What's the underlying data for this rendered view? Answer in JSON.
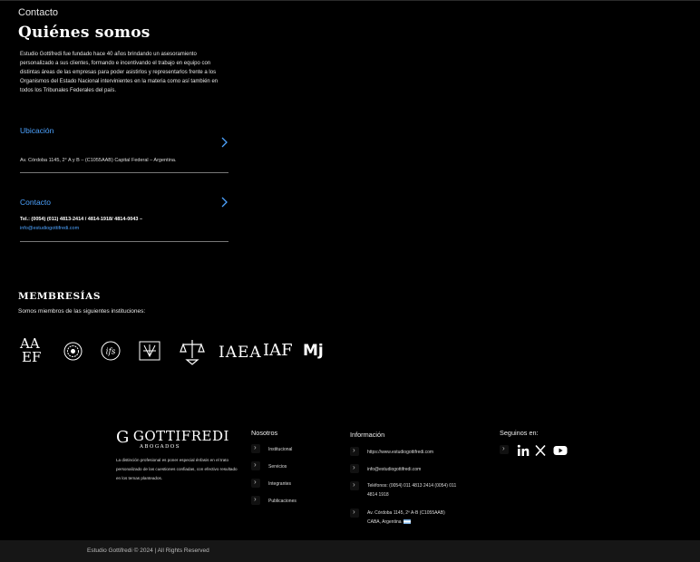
{
  "breadcrumb": "Contacto",
  "page_title": "Quiénes somos",
  "about": "Estudio Gottifredi fue fundado hace 40 años brindando un asesoramiento personalizado a sus clientes, formando e incentivando el trabajo en equipo con distintas áreas de las empresas para poder asistirlos y representarlos frente a los Organismos del Estado Nacional intervinientes en la materia como así también en todos los Tribunales Federales del país.",
  "ubicacion": {
    "label": "Ubicación",
    "address": "Av. Córdoba 1145, 2° A y B – (C1055AAB) Capital Federal – Argentina."
  },
  "contacto": {
    "label": "Contacto",
    "phones": "Tel.: (0054) (011) 4813-2414 / 4814-1918/ 4814-0043 –",
    "email": "info@estudiogottifredi.com"
  },
  "membresias": {
    "title": "MEMBRESÍAS",
    "subtitle": "Somos miembros de las siguientes instituciones:",
    "logos": {
      "aaef_top": "AA",
      "aaef_bottom": "EF",
      "ifs": "ifs",
      "iaea": "IAEA",
      "iaf": "IAF",
      "mj": "Mj"
    }
  },
  "footer": {
    "brand": "GOTTIFREDI",
    "brand_initial": "G",
    "brand_sub": "ABOGADOS",
    "description": "La distinción profesional es poner especial énfasis en el trato personalizado de las cuestiones confiadas, con efectivo resultado en los temas planteados.",
    "nosotros": {
      "heading": "Nosotros",
      "items": [
        "Institucional",
        "Servicios",
        "Integrantes",
        "Publicaciones"
      ]
    },
    "informacion": {
      "heading": "Información",
      "web": "https://www.estudiogottifredi.com",
      "email": "info@estudiogottifredi.com",
      "tel_1": "Teléfonos: (0054) 011 4813 2414 (0054) 011",
      "tel_2": "4814 1918",
      "addr_1": "Av. Córdoba 1145, 2º A-B  (C1055AAB)",
      "addr_2": "CABA, Argentina"
    },
    "social": {
      "heading": "Seguinos en:",
      "networks": [
        "linkedin-icon",
        "x-icon",
        "youtube-icon"
      ]
    }
  },
  "copyright": "Estudio Gottifredi © 2024 | All Rights Reserved"
}
